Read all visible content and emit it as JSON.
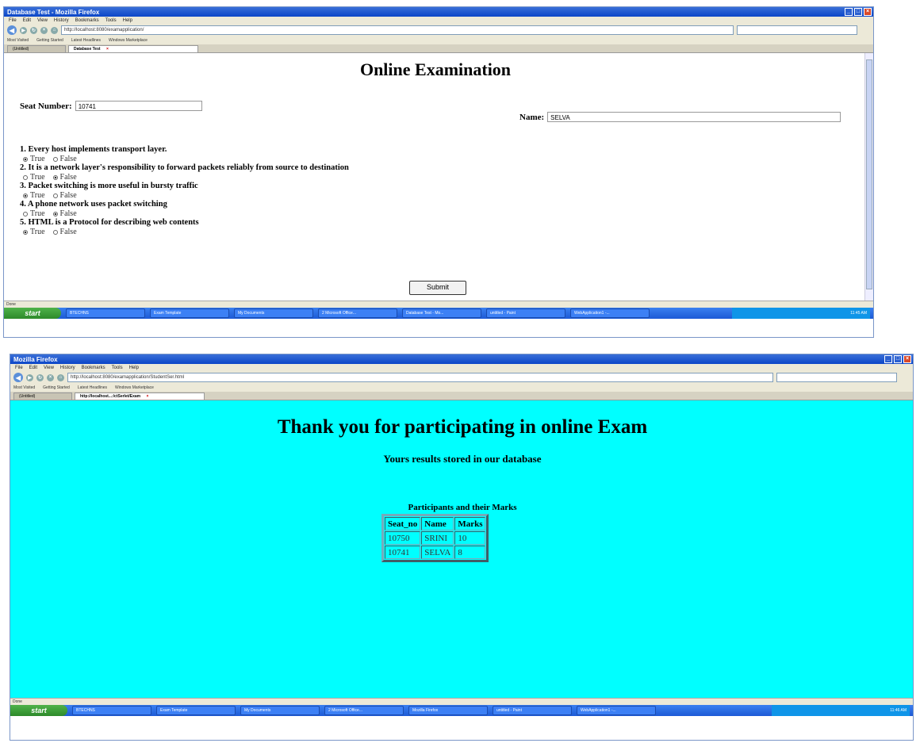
{
  "screen1": {
    "window_title": "Database Test - Mozilla Firefox",
    "menu": [
      "File",
      "Edit",
      "View",
      "History",
      "Bookmarks",
      "Tools",
      "Help"
    ],
    "url": "http://localhost:8080/examapplication/",
    "bookmarks": [
      "Most Visited",
      "Getting Started",
      "Latest Headlines",
      "Windows Marketplace"
    ],
    "tabs": [
      "(Untitled)",
      "Database Test"
    ],
    "page_title": "Online Examination",
    "seat_label": "Seat Number:",
    "seat_value": "10741",
    "name_label": "Name:",
    "name_value": "SELVA",
    "questions": [
      {
        "text": "1. Every host implements transport layer.",
        "selected": "True"
      },
      {
        "text": "2. It is a network layer's responsibility to forward packets reliably from source to destination",
        "selected": "False"
      },
      {
        "text": "3. Packet switching is more useful in bursty traffic",
        "selected": "True"
      },
      {
        "text": "4. A phone network uses packet switching",
        "selected": "False"
      },
      {
        "text": "5. HTML is a Protocol for describing web contents",
        "selected": "True"
      }
    ],
    "option_true": "True",
    "option_false": "False",
    "submit_label": "Submit",
    "status": "Done",
    "taskbar": {
      "start": "start",
      "items": [
        "BTECHNS",
        "Exam Template",
        "My Documents",
        "2 Microsoft Office...",
        "Database Test - Mo...",
        "untitled - Paint",
        "WebApplication1 -..."
      ],
      "clock": "11:45 AM"
    }
  },
  "screen2": {
    "window_title": "Mozilla Firefox",
    "menu": [
      "File",
      "Edit",
      "View",
      "History",
      "Bookmarks",
      "Tools",
      "Help"
    ],
    "url": "http://localhost:8080/examapplication/StudentSer.html",
    "bookmarks": [
      "Most Visited",
      "Getting Started",
      "Latest Headlines",
      "Windows Marketplace"
    ],
    "tabs": [
      "(Untitled)",
      "http://localhost...:/ctSerlet/Exam"
    ],
    "heading": "Thank you for participating in online Exam",
    "subheading": "Yours results stored in our database",
    "table_title": "Participants and their Marks",
    "table_headers": [
      "Seat_no",
      "Name",
      "Marks"
    ],
    "table_rows": [
      [
        "10750",
        "SRINI",
        "10"
      ],
      [
        "10741",
        "SELVA",
        "8"
      ]
    ],
    "status": "Done",
    "taskbar": {
      "start": "start",
      "items": [
        "BTECHNS",
        "Exam Template",
        "My Documents",
        "2 Microsoft Office...",
        "Mozilla Firefox",
        "untitled - Paint",
        "WebApplication1 -..."
      ],
      "clock": "11:46 AM"
    }
  },
  "colors": {
    "cyan_background": "#00ffff",
    "xp_blue": "#0b46c8",
    "start_green": "#2d8a2a"
  }
}
